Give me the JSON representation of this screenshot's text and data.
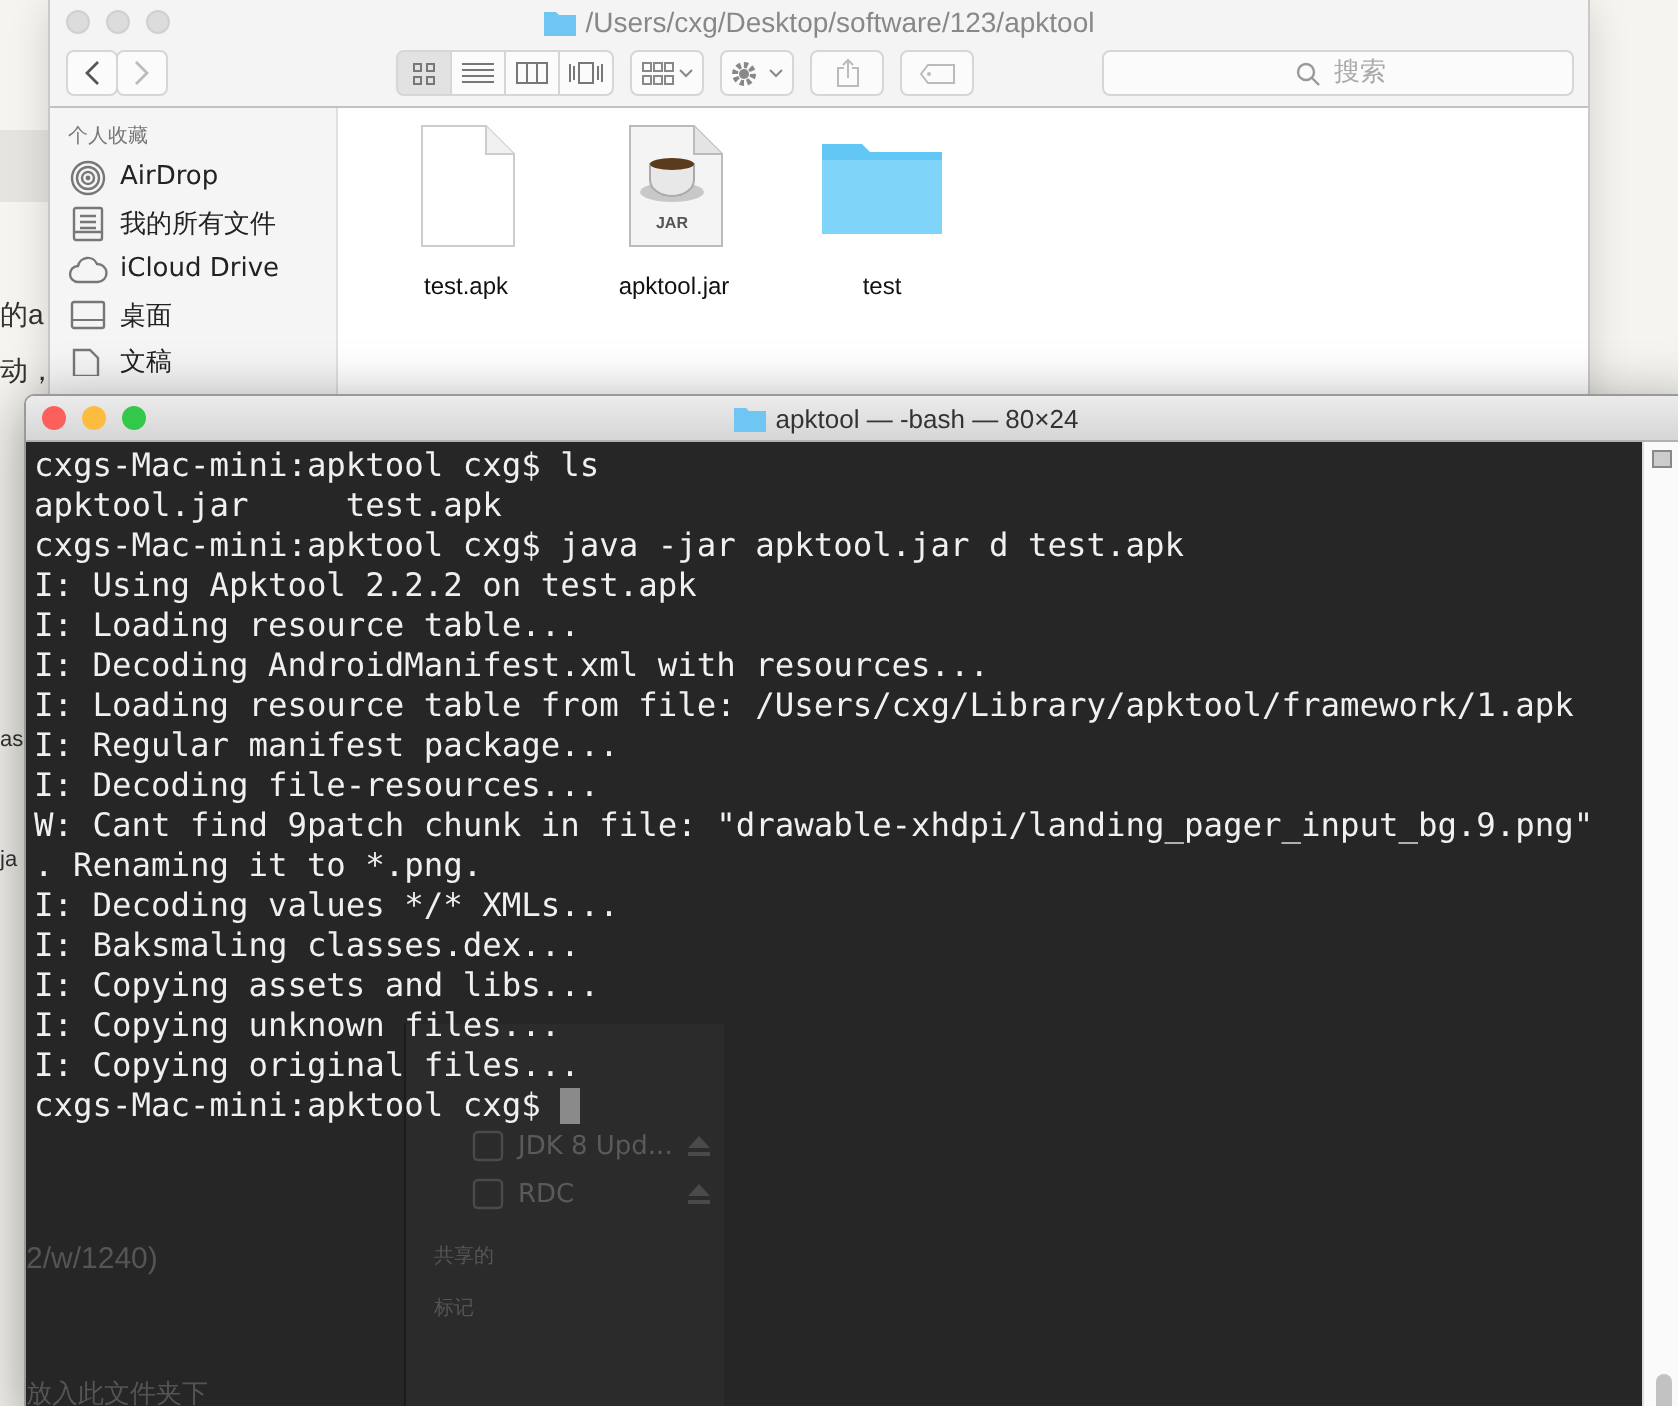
{
  "background_page": {
    "fragments": [
      {
        "text": "的a"
      },
      {
        "text": "动，"
      },
      {
        "text": "as"
      },
      {
        "text": "ja"
      }
    ]
  },
  "finder": {
    "title": "/Users/cxg/Desktop/software/123/apktool",
    "search": {
      "placeholder": "搜索"
    },
    "views": [
      {
        "kind": "icons",
        "selected": true
      },
      {
        "kind": "list",
        "selected": false
      },
      {
        "kind": "columns",
        "selected": false
      },
      {
        "kind": "coverflow",
        "selected": false
      }
    ],
    "sidebar": {
      "header": "个人收藏",
      "items": [
        {
          "kind": "airdrop",
          "label": "AirDrop"
        },
        {
          "kind": "files",
          "label": "我的所有文件"
        },
        {
          "kind": "cloud",
          "label": "iCloud Drive"
        },
        {
          "kind": "desktop",
          "label": "桌面"
        },
        {
          "kind": "docs",
          "label": "文稿"
        }
      ]
    },
    "files": [
      {
        "kind": "document",
        "name": "test.apk"
      },
      {
        "kind": "jar",
        "name": "apktool.jar",
        "badge": "JAR"
      },
      {
        "kind": "folder",
        "name": "test"
      }
    ]
  },
  "terminal": {
    "title": "apktool — -bash — 80×24",
    "lines": [
      "cxgs-Mac-mini:apktool cxg$ ls",
      "apktool.jar     test.apk",
      "cxgs-Mac-mini:apktool cxg$ java -jar apktool.jar d test.apk",
      "I: Using Apktool 2.2.2 on test.apk",
      "I: Loading resource table...",
      "I: Decoding AndroidManifest.xml with resources...",
      "I: Loading resource table from file: /Users/cxg/Library/apktool/framework/1.apk",
      "I: Regular manifest package...",
      "I: Decoding file-resources...",
      "W: Cant find 9patch chunk in file: \"drawable-xhdpi/landing_pager_input_bg.9.png\"",
      ". Renaming it to *.png.",
      "I: Decoding values */* XMLs...",
      "I: Baksmaling classes.dex...",
      "I: Copying assets and libs...",
      "I: Copying unknown files...",
      "I: Copying original files..."
    ],
    "prompt": "cxgs-Mac-mini:apktool cxg$ ",
    "behind": {
      "devices": [
        {
          "label": "JDK 8 Upd..."
        },
        {
          "label": "RDC"
        }
      ],
      "sections": [
        "共享的",
        "标记"
      ],
      "page_texts": [
        "2/w/1240)",
        "放入此文件夹下"
      ]
    }
  }
}
